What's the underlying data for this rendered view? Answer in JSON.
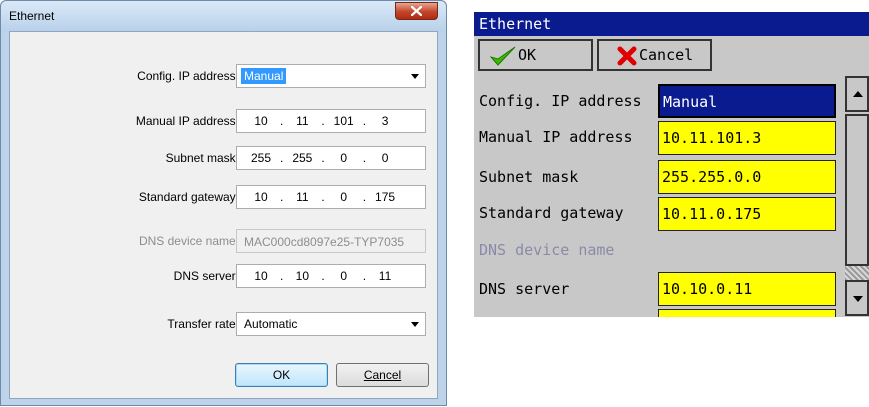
{
  "left_dialog": {
    "title": "Ethernet",
    "config_ip": {
      "label": "Config. IP address:",
      "value": "Manual"
    },
    "manual_ip": {
      "label": "Manual IP address:",
      "octets": [
        "10",
        "11",
        "101",
        "3"
      ]
    },
    "subnet": {
      "label": "Subnet mask:",
      "octets": [
        "255",
        "255",
        "0",
        "0"
      ]
    },
    "gateway": {
      "label": "Standard gateway:",
      "octets": [
        "10",
        "11",
        "0",
        "175"
      ]
    },
    "dns_name": {
      "label": "DNS device name:",
      "value": "MAC000cd8097e25-TYP7035"
    },
    "dns_server": {
      "label": "DNS server:",
      "octets": [
        "10",
        "10",
        "0",
        "11"
      ]
    },
    "transfer_rate": {
      "label": "Transfer rate:",
      "value": "Automatic"
    },
    "ok_label": "OK",
    "cancel_label": "Cancel",
    "dot": "."
  },
  "right_panel": {
    "title": "Ethernet",
    "ok_label": "OK",
    "cancel_label": "Cancel",
    "rows": {
      "config_ip": {
        "label": "Config. IP address",
        "value": "Manual"
      },
      "manual_ip": {
        "label": "Manual IP address",
        "value": "10.11.101.3"
      },
      "subnet": {
        "label": "Subnet mask",
        "value": "255.255.0.0"
      },
      "gateway": {
        "label": "Standard gateway",
        "value": "10.11.0.175"
      },
      "dns_name": {
        "label": "DNS device name"
      },
      "dns_server": {
        "label": "DNS server",
        "value": "10.10.0.11"
      }
    }
  }
}
